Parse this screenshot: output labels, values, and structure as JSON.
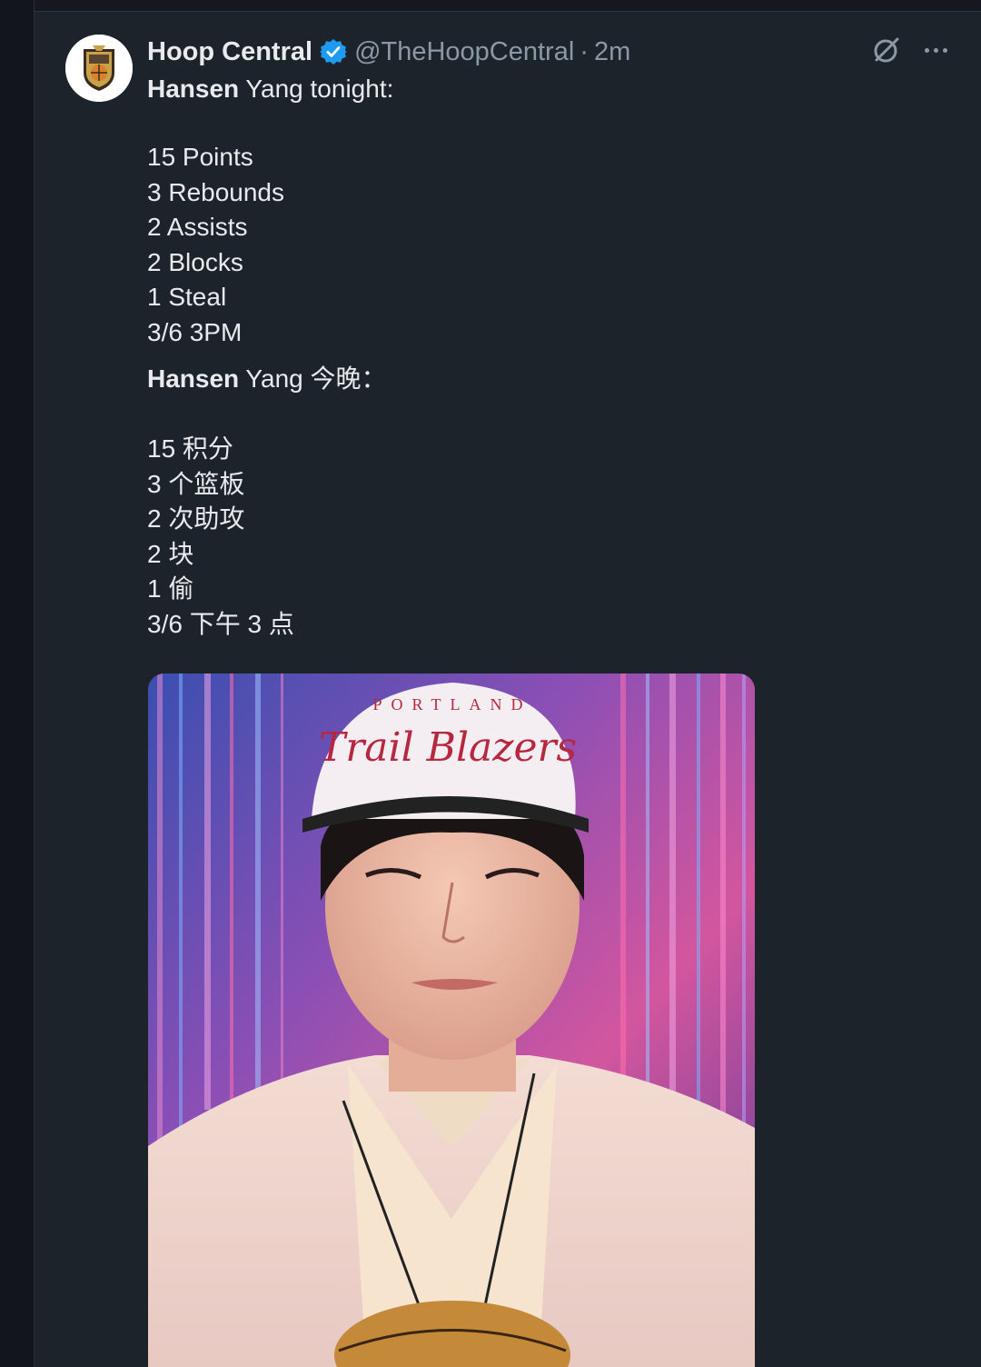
{
  "tweet": {
    "display_name": "Hoop Central",
    "handle": "@TheHoopCentral",
    "separator": "·",
    "time": "2m",
    "en_intro_bold": "Hansen",
    "en_intro_rest": " Yang tonight:",
    "en_stats": [
      "15 Points",
      "3 Rebounds",
      "2 Assists",
      "2 Blocks",
      "1 Steal",
      "3/6 3PM"
    ],
    "zh_intro_bold": "Hansen",
    "zh_intro_rest": " Yang 今晚：",
    "zh_stats": [
      "15 积分",
      "3 个篮板",
      "2 次助攻",
      "2 块",
      "1 偷",
      "3/6 下午 3 点"
    ]
  },
  "icons": {
    "verified": "verified-badge-icon",
    "grok": "grok-icon",
    "more": "more-icon"
  },
  "colors": {
    "background": "#1d232b",
    "text": "#e8eaed",
    "muted": "#8b98a5",
    "verified_blue": "#1d9bf0"
  },
  "media": {
    "cap_text_top": "PORTLAND",
    "cap_text_script": "Trail Blazers"
  }
}
